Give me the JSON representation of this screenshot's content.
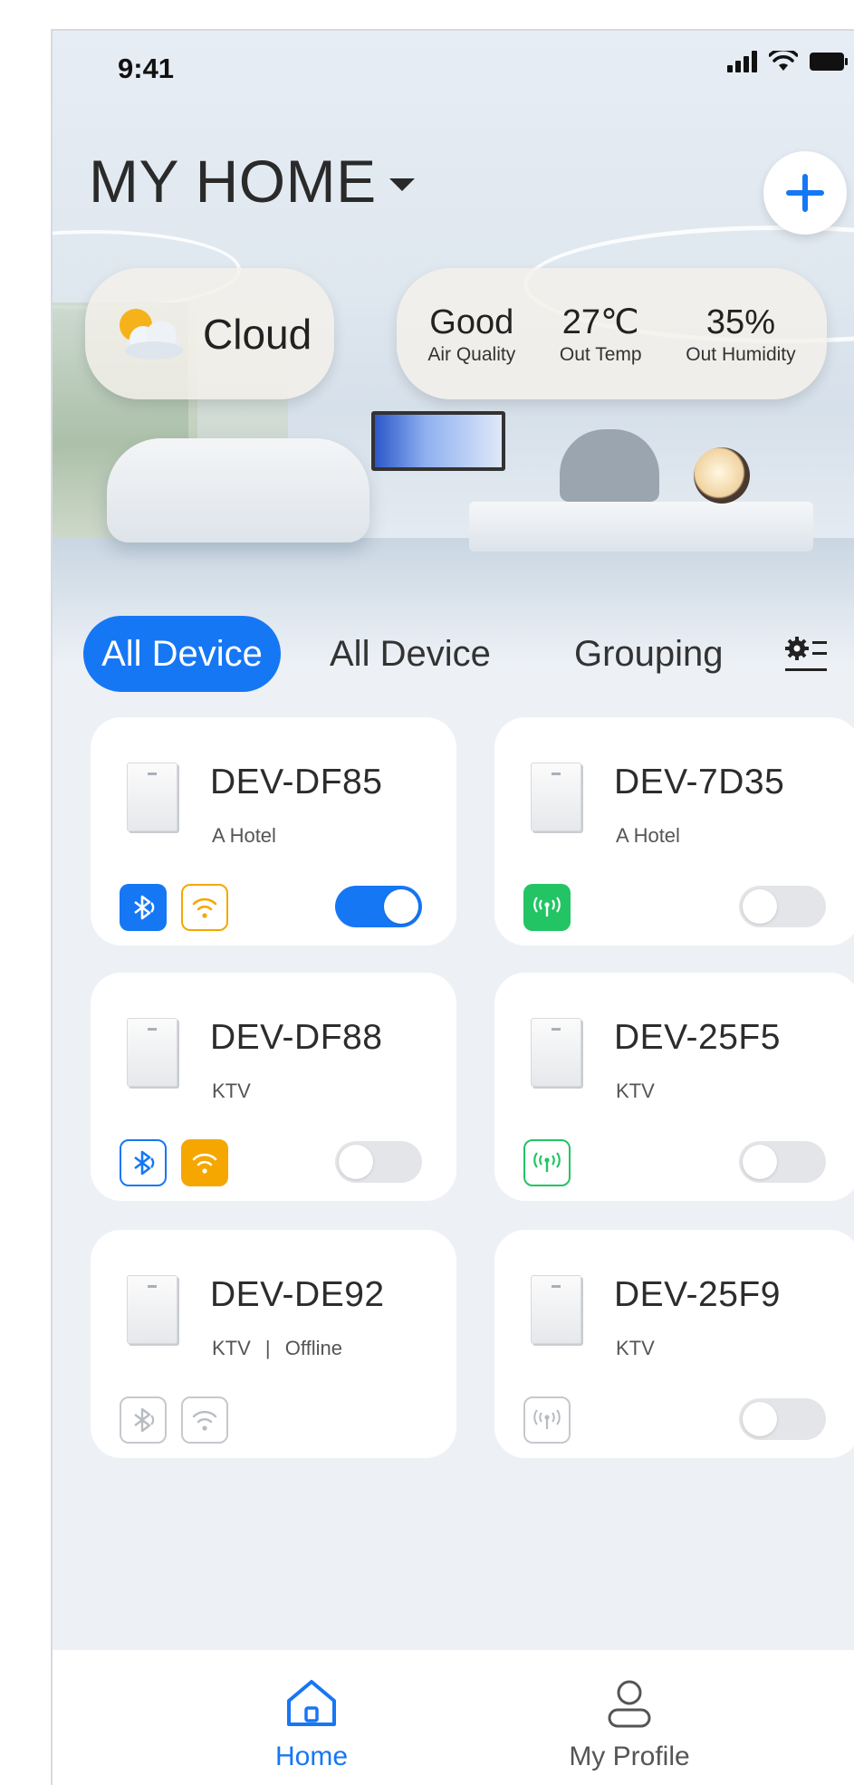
{
  "status_bar": {
    "time": "9:41"
  },
  "header": {
    "home_name": "MY HOME"
  },
  "weather": {
    "condition": "Cloud"
  },
  "environment": [
    {
      "value": "Good",
      "label": "Air Quality"
    },
    {
      "value": "27℃",
      "label": "Out Temp"
    },
    {
      "value": "35%",
      "label": "Out Humidity"
    }
  ],
  "tabs": [
    {
      "label": "All Device",
      "active": true
    },
    {
      "label": "All Device",
      "active": false
    },
    {
      "label": "Grouping",
      "active": false
    }
  ],
  "devices": [
    {
      "name": "DEV-DF85",
      "location": "A Hotel",
      "status": "",
      "connections": [
        "bluetooth-active",
        "wifi-outline"
      ],
      "power_on": true
    },
    {
      "name": "DEV-7D35",
      "location": "A Hotel",
      "status": "",
      "connections": [
        "cellular-active"
      ],
      "power_on": false
    },
    {
      "name": "DEV-DF88",
      "location": "KTV",
      "status": "",
      "connections": [
        "bluetooth-outline",
        "wifi-active"
      ],
      "power_on": false
    },
    {
      "name": "DEV-25F5",
      "location": "KTV",
      "status": "",
      "connections": [
        "cellular-outline"
      ],
      "power_on": false
    },
    {
      "name": "DEV-DE92",
      "location": "KTV",
      "status": "Offline",
      "connections": [
        "bluetooth-offline",
        "wifi-offline"
      ],
      "power_on": false
    },
    {
      "name": "DEV-25F9",
      "location": "KTV",
      "status": "",
      "connections": [
        "cellular-offline"
      ],
      "power_on": false
    }
  ],
  "bottom_nav": [
    {
      "label": "Home",
      "icon": "home-icon",
      "active": true
    },
    {
      "label": "My Profile",
      "icon": "profile-icon",
      "active": false
    }
  ],
  "colors": {
    "accent": "#1677f5",
    "wifi": "#f5a700",
    "cellular": "#23c464",
    "inactive": "#b8bcc2"
  }
}
